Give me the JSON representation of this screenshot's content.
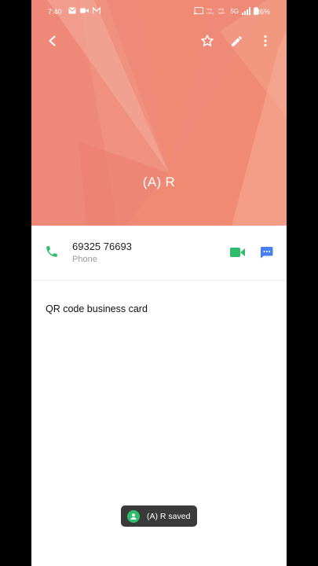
{
  "status_bar": {
    "time": "7:40",
    "battery": "86%",
    "network": "5G",
    "left_icons": [
      "mail-icon",
      "video-cam-icon",
      "gmail-icon"
    ],
    "right_icons": [
      "cast-icon",
      "volte-icon",
      "vowifi-icon",
      "signal-icon",
      "battery-icon"
    ]
  },
  "header": {
    "back_icon": "back-arrow-icon",
    "favorite_icon": "star-icon",
    "edit_icon": "pencil-icon",
    "more_icon": "more-vert-icon",
    "contact_name": "(A) R",
    "background_color": "#ef8a78"
  },
  "phone_entry": {
    "number": "69325 76693",
    "type": "Phone",
    "call_icon": "phone-icon",
    "video_icon": "video-call-icon",
    "message_icon": "message-icon",
    "call_color": "#2ebd6a",
    "message_color": "#4a7ff0"
  },
  "qr_card": {
    "label": "QR code business card"
  },
  "toast": {
    "text": "(A) R saved",
    "icon": "person-icon"
  }
}
